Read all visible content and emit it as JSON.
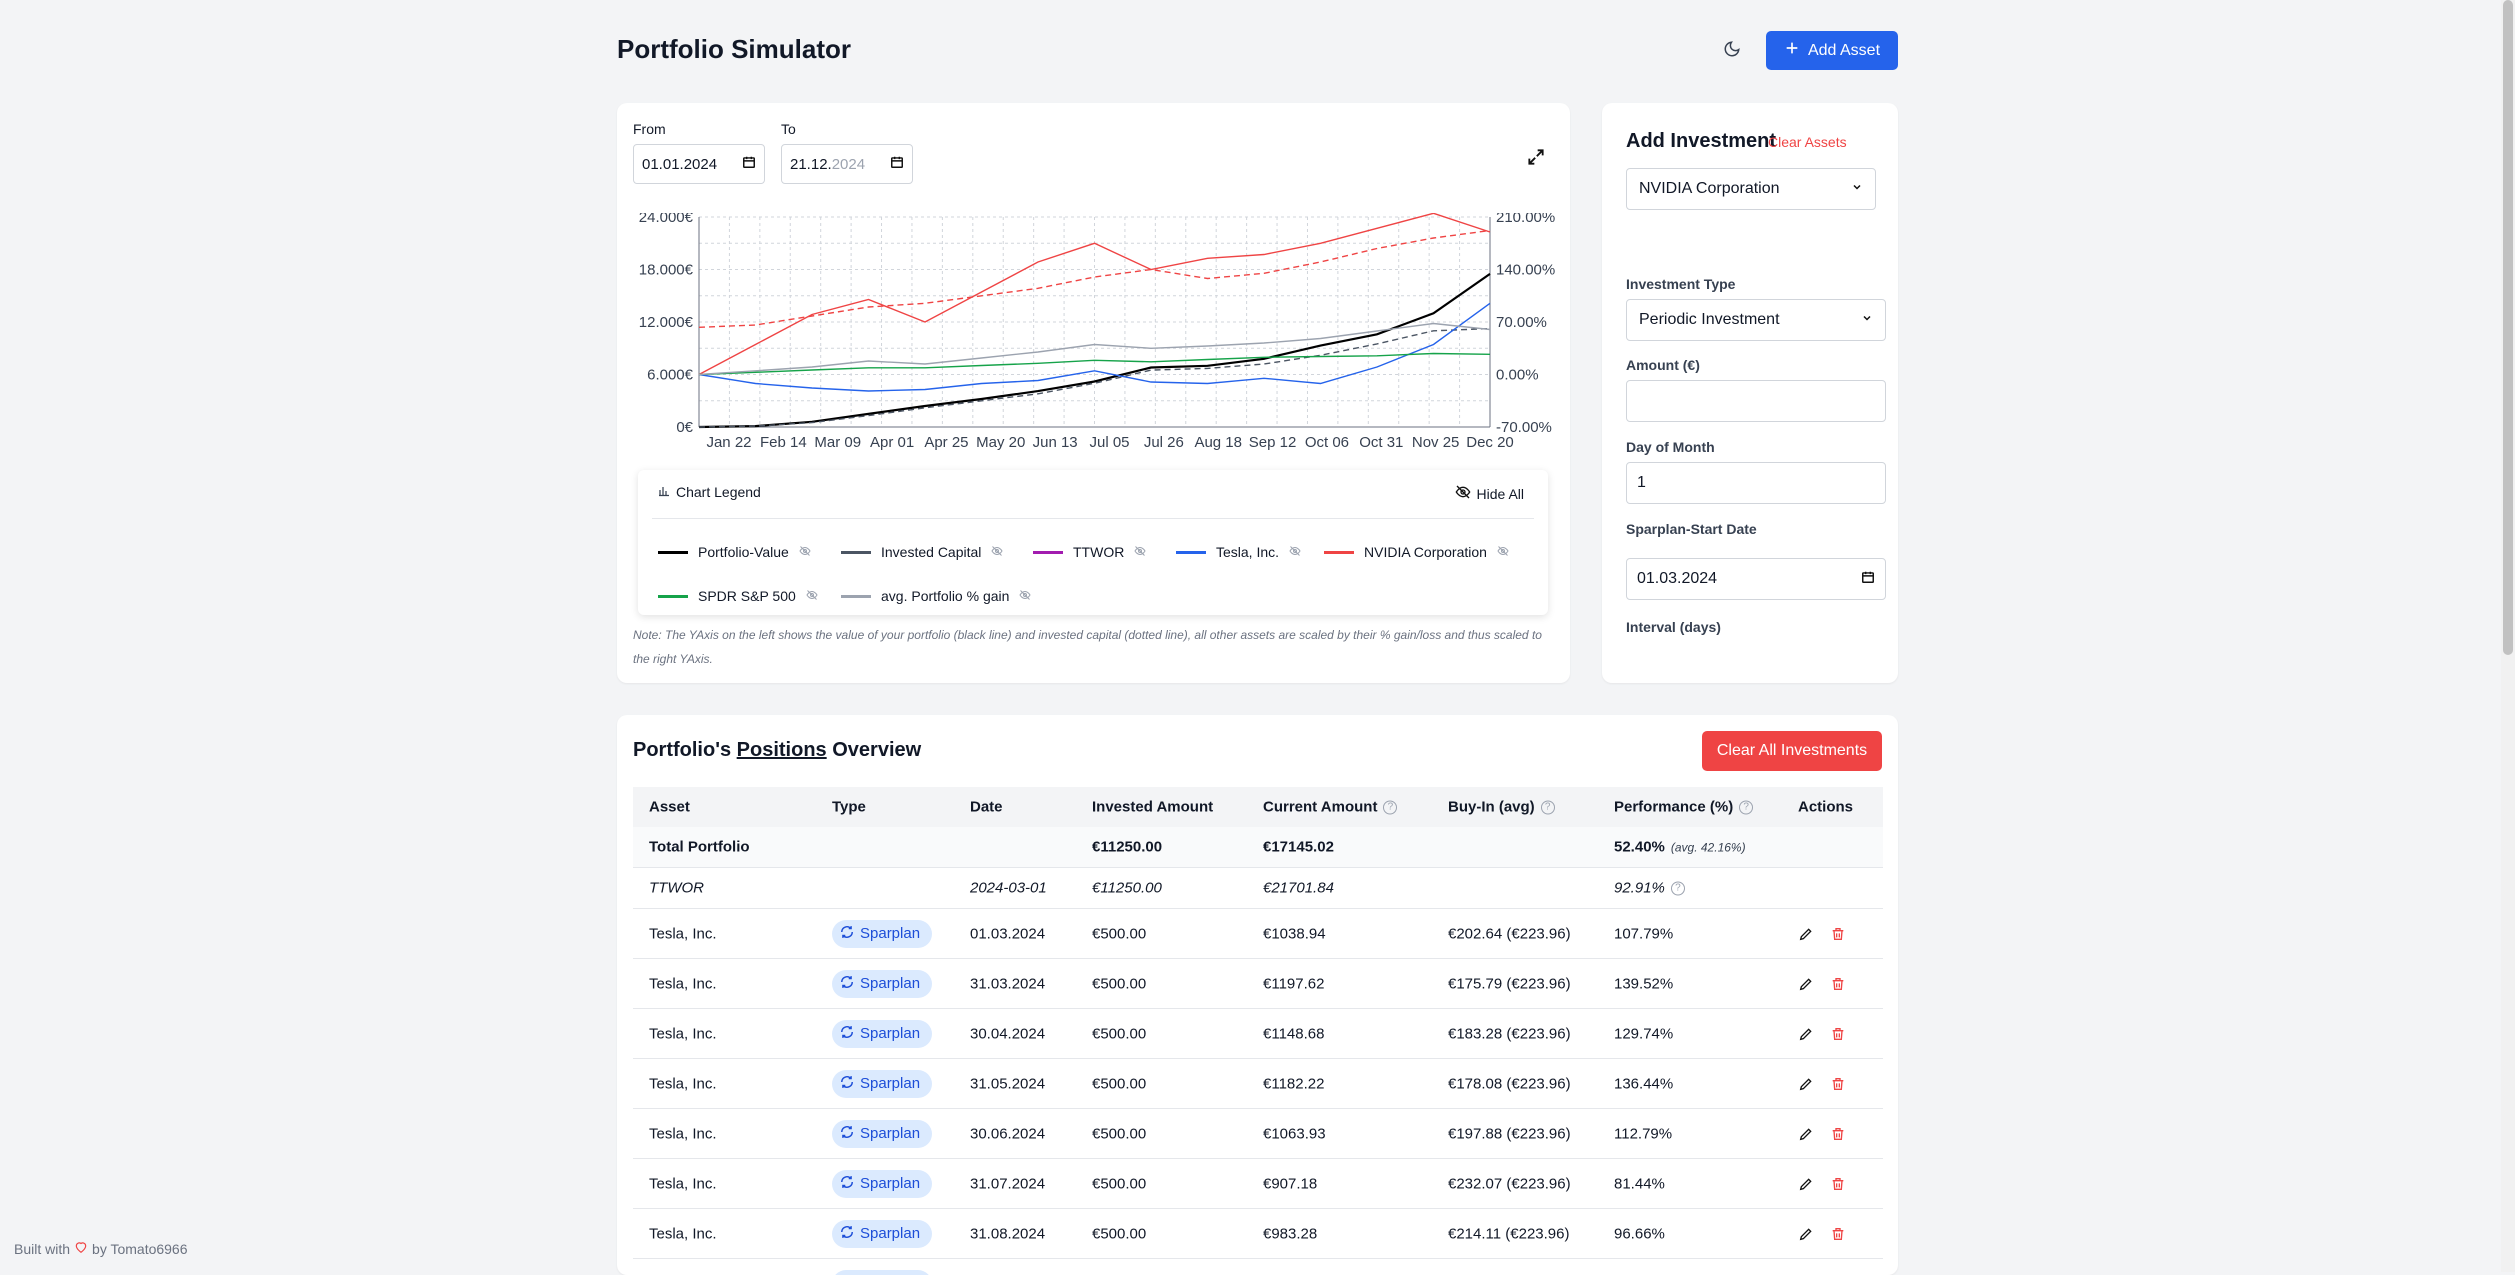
{
  "header": {
    "title": "Portfolio Simulator",
    "add_asset_label": "Add Asset"
  },
  "chart_controls": {
    "from_label": "From",
    "from_value": "01.01.2024",
    "to_label": "To",
    "to_value_day": "21.12.",
    "to_value_year": "2024"
  },
  "chart_data": {
    "type": "line",
    "x": [
      "Jan 22",
      "Feb 14",
      "Mar 09",
      "Apr 01",
      "Apr 25",
      "May 20",
      "Jun 13",
      "Jul 05",
      "Jul 26",
      "Aug 18",
      "Sep 12",
      "Oct 06",
      "Oct 31",
      "Nov 25",
      "Dec 20"
    ],
    "y_left_ticks": [
      "24.000€",
      "18.000€",
      "12.000€",
      "6.000€",
      "0€"
    ],
    "y_left_range": [
      0,
      24000
    ],
    "y_right_ticks": [
      "210.00%",
      "140.00%",
      "70.00%",
      "0.00%",
      "-70.00%"
    ],
    "y_right_range": [
      -70,
      210
    ],
    "grid": true,
    "series": [
      {
        "name": "Portfolio-Value",
        "color": "#000000",
        "axis": "left",
        "values": [
          0,
          100,
          600,
          1500,
          2400,
          3200,
          4100,
          5200,
          6800,
          7000,
          7800,
          9300,
          10600,
          13000,
          17500
        ]
      },
      {
        "name": "Invested Capital",
        "color": "#4b5563",
        "axis": "left",
        "dashed": true,
        "values": [
          0,
          100,
          500,
          1300,
          2200,
          3000,
          3800,
          5000,
          6500,
          6700,
          7200,
          8200,
          9500,
          11000,
          11250
        ]
      },
      {
        "name": "TTWOR",
        "color": "#ef4444",
        "axis": "right",
        "dashed": true,
        "values": [
          63,
          66,
          78,
          90,
          95,
          105,
          115,
          130,
          140,
          128,
          135,
          150,
          168,
          182,
          192
        ]
      },
      {
        "name": "Tesla, Inc.",
        "color": "#2563eb",
        "axis": "right",
        "values": [
          0,
          -12,
          -18,
          -22,
          -20,
          -12,
          -8,
          5,
          -10,
          -12,
          -5,
          -12,
          10,
          40,
          95
        ]
      },
      {
        "name": "NVIDIA Corporation",
        "color": "#ef4444",
        "axis": "right",
        "values": [
          0,
          40,
          80,
          100,
          70,
          110,
          150,
          175,
          140,
          155,
          160,
          175,
          195,
          215,
          190
        ]
      },
      {
        "name": "SPDR S&P 500",
        "color": "#16a34a",
        "axis": "right",
        "values": [
          0,
          3,
          6,
          9,
          9,
          12,
          15,
          19,
          17,
          20,
          23,
          24,
          25,
          28,
          27
        ]
      },
      {
        "name": "avg. Portfolio % gain",
        "color": "#9ca3af",
        "axis": "right",
        "values": [
          0,
          5,
          10,
          18,
          14,
          22,
          30,
          40,
          35,
          38,
          42,
          48,
          58,
          68,
          60
        ]
      }
    ]
  },
  "legend": {
    "title": "Chart Legend",
    "hide_all_label": "Hide All",
    "items": [
      {
        "label": "Portfolio-Value",
        "color": "#000000"
      },
      {
        "label": "Invested Capital",
        "color": "#4b5563"
      },
      {
        "label": "TTWOR",
        "color": "#a21caf"
      },
      {
        "label": "Tesla, Inc.",
        "color": "#2563eb"
      },
      {
        "label": "NVIDIA Corporation",
        "color": "#ef4444"
      },
      {
        "label": "SPDR S&P 500",
        "color": "#16a34a"
      },
      {
        "label": "avg. Portfolio % gain",
        "color": "#9ca3af"
      }
    ]
  },
  "note": "Note: The YAxis on the left shows the value of your portfolio (black line) and invested capital (dotted line), all other assets are scaled by their % gain/loss and thus scaled to the right YAxis.",
  "add_investment": {
    "title": "Add Investment",
    "clear_assets_label": "Clear Assets",
    "asset_selected": "NVIDIA Corporation",
    "investment_type_label": "Investment Type",
    "investment_type_selected": "Periodic Investment",
    "amount_label": "Amount (€)",
    "amount_value": "",
    "day_label": "Day of Month",
    "day_value": "1",
    "start_date_label": "Sparplan-Start Date",
    "start_date_value": "01.03.2024",
    "interval_label": "Interval (days)"
  },
  "positions": {
    "title_prefix": "Portfolio's ",
    "title_underline": "Positions",
    "title_suffix": " Overview",
    "clear_all_label": "Clear All Investments",
    "headers": [
      "Asset",
      "Type",
      "Date",
      "Invested Amount",
      "Current Amount",
      "Buy-In (avg)",
      "Performance (%)",
      "Actions"
    ],
    "total": {
      "asset": "Total Portfolio",
      "invested": "€11250.00",
      "current": "€17145.02",
      "perf": "52.40%",
      "avg": "(avg. 42.16%)"
    },
    "ttwor": {
      "asset": "TTWOR",
      "date": "2024-03-01",
      "invested": "€11250.00",
      "current": "€21701.84",
      "perf": "92.91%"
    },
    "rows": [
      {
        "asset": "Tesla, Inc.",
        "type": "Sparplan",
        "date": "01.03.2024",
        "invested": "€500.00",
        "current": "€1038.94",
        "buyin": "€202.64 (€223.96)",
        "perf": "107.79%"
      },
      {
        "asset": "Tesla, Inc.",
        "type": "Sparplan",
        "date": "31.03.2024",
        "invested": "€500.00",
        "current": "€1197.62",
        "buyin": "€175.79 (€223.96)",
        "perf": "139.52%"
      },
      {
        "asset": "Tesla, Inc.",
        "type": "Sparplan",
        "date": "30.04.2024",
        "invested": "€500.00",
        "current": "€1148.68",
        "buyin": "€183.28 (€223.96)",
        "perf": "129.74%"
      },
      {
        "asset": "Tesla, Inc.",
        "type": "Sparplan",
        "date": "31.05.2024",
        "invested": "€500.00",
        "current": "€1182.22",
        "buyin": "€178.08 (€223.96)",
        "perf": "136.44%"
      },
      {
        "asset": "Tesla, Inc.",
        "type": "Sparplan",
        "date": "30.06.2024",
        "invested": "€500.00",
        "current": "€1063.93",
        "buyin": "€197.88 (€223.96)",
        "perf": "112.79%"
      },
      {
        "asset": "Tesla, Inc.",
        "type": "Sparplan",
        "date": "31.07.2024",
        "invested": "€500.00",
        "current": "€907.18",
        "buyin": "€232.07 (€223.96)",
        "perf": "81.44%"
      },
      {
        "asset": "Tesla, Inc.",
        "type": "Sparplan",
        "date": "31.08.2024",
        "invested": "€500.00",
        "current": "€983.28",
        "buyin": "€214.11 (€223.96)",
        "perf": "96.66%"
      },
      {
        "asset": "",
        "type": "Sparplan",
        "date": "",
        "invested": "",
        "current": "",
        "buyin": "",
        "perf": ""
      }
    ]
  },
  "footer": {
    "prefix": "Built with",
    "suffix": "by Tomato6966"
  }
}
